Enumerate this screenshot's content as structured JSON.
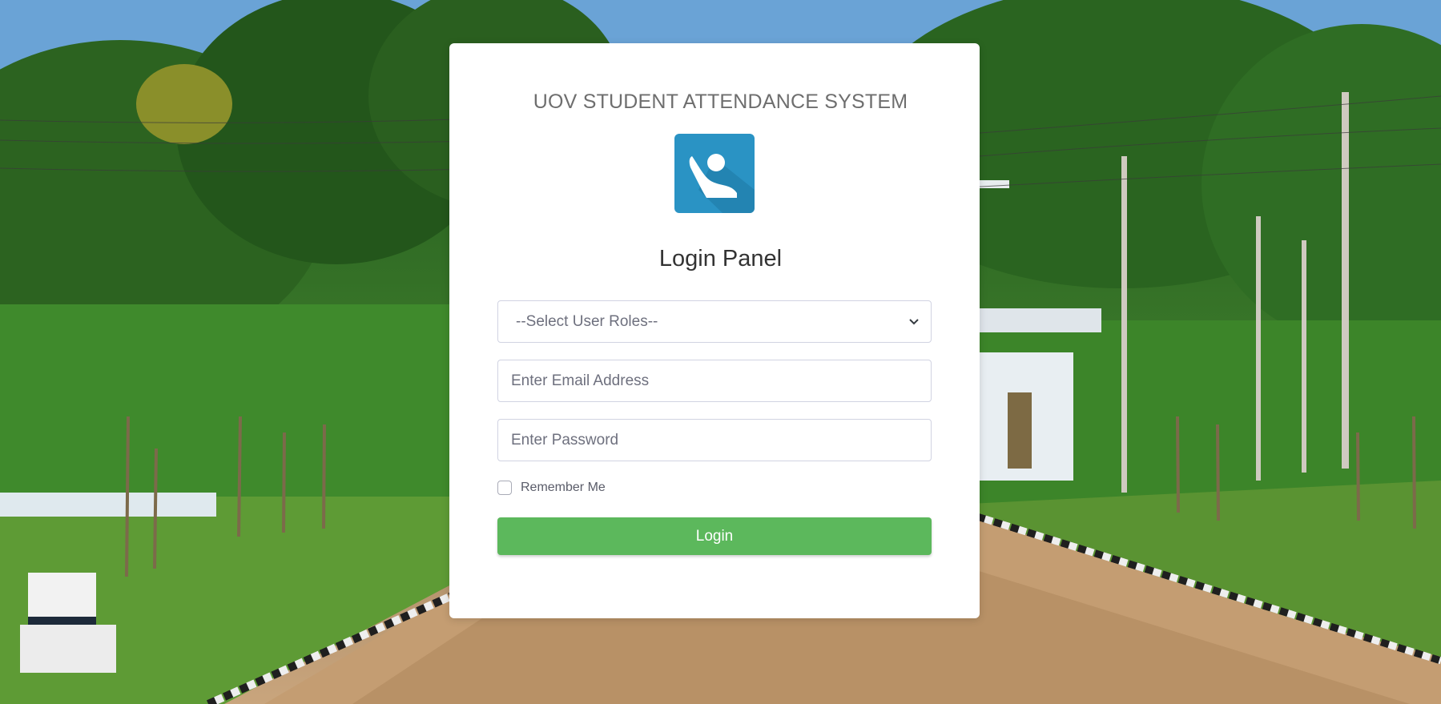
{
  "header": {
    "system_title": "UOV STUDENT ATTENDANCE SYSTEM",
    "panel_title": "Login Panel"
  },
  "form": {
    "role_select": {
      "selected": "--Select User Roles--"
    },
    "email": {
      "placeholder": "Enter Email Address",
      "value": ""
    },
    "password": {
      "placeholder": "Enter Password",
      "value": ""
    },
    "remember_label": "Remember Me",
    "remember_checked": false,
    "login_label": "Login"
  },
  "icons": {
    "logo": "student-hand-raised-icon",
    "dropdown": "chevron-down-icon"
  },
  "colors": {
    "logo_bg": "#2a93c4",
    "login_button": "#5cb85c",
    "card_bg": "#ffffff"
  }
}
